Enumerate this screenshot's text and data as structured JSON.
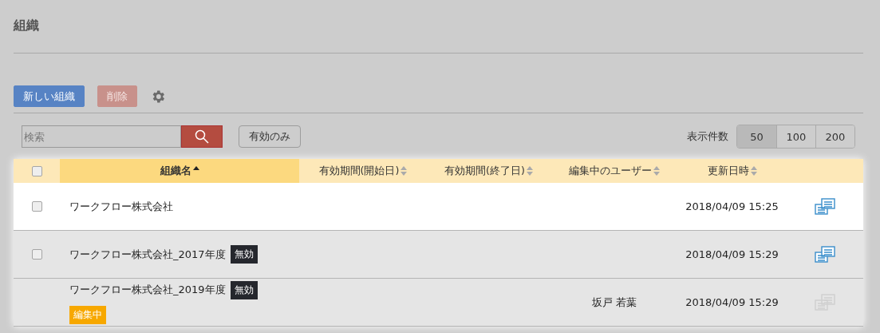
{
  "page_title": "組織",
  "toolbar": {
    "new_button": "新しい組織",
    "delete_button": {
      "label": "削除",
      "disabled": true
    }
  },
  "search": {
    "placeholder": "検索",
    "filter_button": "有効のみ"
  },
  "page_size": {
    "label": "表示件数",
    "options": [
      {
        "label": "50",
        "selected": true
      },
      {
        "label": "100",
        "selected": false
      },
      {
        "label": "200",
        "selected": false
      }
    ]
  },
  "table": {
    "select_all": {
      "checked": false
    },
    "columns": [
      {
        "label": "組織名",
        "sorted": true
      },
      {
        "label": "有効期間(開始日)",
        "sorted": false
      },
      {
        "label": "有効期間(終了日)",
        "sorted": false
      },
      {
        "label": "編集中のユーザー",
        "sorted": false
      },
      {
        "label": "更新日時",
        "sorted": false
      }
    ],
    "rows": [
      {
        "selectable": true,
        "checked": false,
        "highlighted": true,
        "name": "ワークフロー株式会社",
        "updated": "2018/04/09 15:25",
        "action_enabled": true
      },
      {
        "selectable": true,
        "checked": false,
        "highlighted": false,
        "name": "ワークフロー株式会社_2017年度",
        "badges": [
          {
            "kind": "inactive",
            "label": "無効"
          }
        ],
        "updated": "2018/04/09 15:29",
        "action_enabled": true
      },
      {
        "selectable": false,
        "highlighted": false,
        "name": "ワークフロー株式会社_2019年度",
        "badges": [
          {
            "kind": "inactive",
            "label": "無効"
          },
          {
            "kind": "editing",
            "label": "編集中"
          }
        ],
        "editor": "坂戸 若葉",
        "updated": "2018/04/09 15:29",
        "action_enabled": false
      }
    ]
  }
}
